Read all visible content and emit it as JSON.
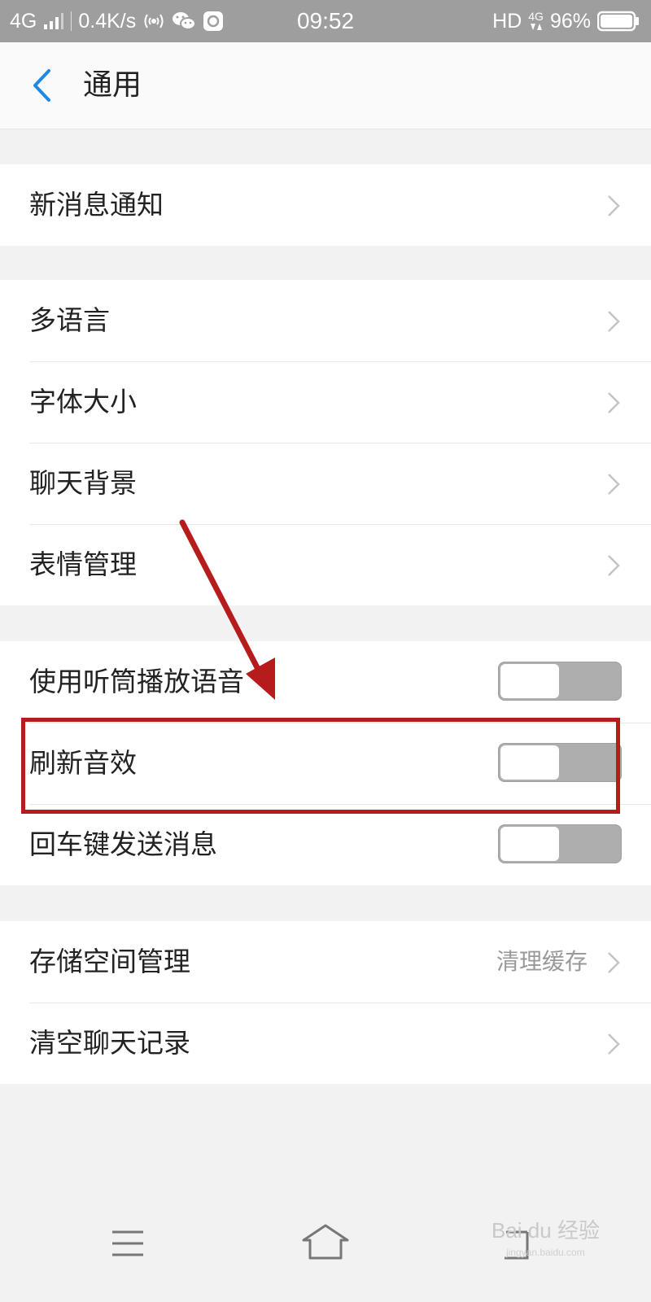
{
  "status": {
    "network": "4G",
    "speed": "0.4K/s",
    "time": "09:52",
    "hd": "HD",
    "net_small": "4G",
    "battery_pct": "96%"
  },
  "header": {
    "title": "通用"
  },
  "groups": [
    {
      "items": [
        {
          "label": "新消息通知"
        }
      ]
    },
    {
      "items": [
        {
          "label": "多语言"
        },
        {
          "label": "字体大小"
        },
        {
          "label": "聊天背景"
        },
        {
          "label": "表情管理"
        }
      ]
    },
    {
      "items": [
        {
          "label": "使用听筒播放语音",
          "toggle": false
        },
        {
          "label": "刷新音效",
          "toggle": false
        },
        {
          "label": "回车键发送消息",
          "toggle": false
        }
      ]
    },
    {
      "items": [
        {
          "label": "存储空间管理",
          "value": "清理缓存"
        },
        {
          "label": "清空聊天记录"
        }
      ]
    }
  ],
  "watermark": {
    "text": "Bai du 经验",
    "sub": "jingyan.baidu.com"
  },
  "colors": {
    "accent": "#1e88e5",
    "annotation": "#b71c1c",
    "toggle_off": "#aeaeae"
  }
}
